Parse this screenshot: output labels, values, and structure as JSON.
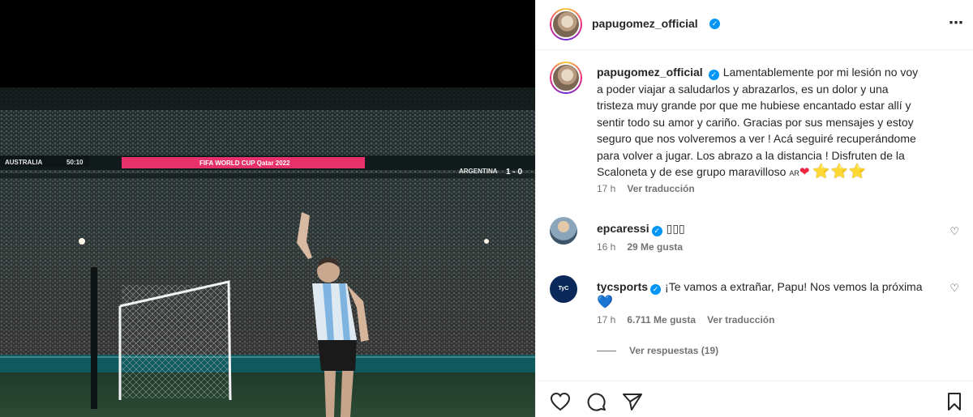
{
  "post": {
    "username": "papugomez_official",
    "more_icon": "⋯"
  },
  "scoreboard": {
    "team_home": "AUSTRALIA",
    "clock": "50:10",
    "banner": "FIFA WORLD CUP Qatar 2022",
    "team_away": "ARGENTINA",
    "score": "1 - 0"
  },
  "caption": {
    "username": "papugomez_official",
    "text": "Lamentablemente por mi lesión no voy a poder viajar a saludarlos y abrazarlos, es un dolor y una tristeza muy grande por que me hubiese encantado estar allí y sentir todo su amor y cariño. Gracias por sus mensajes y estoy seguro que nos volveremos a ver ! Acá seguiré recuperándome para volver a jugar. Los abrazo a la distancia ! Disfruten de la Scaloneta y de ese grupo maravilloso",
    "flag": "AR",
    "heart": "❤",
    "stars": "⭐⭐⭐",
    "time": "17 h",
    "translate": "Ver traducción"
  },
  "comments": [
    {
      "username": "epcaressi",
      "text": "▯▯▯",
      "time": "16 h",
      "likes": "29 Me gusta"
    },
    {
      "username": "tycsports",
      "avatar_label": "TyC Sports",
      "text": "¡Te vamos a extrañar, Papu! Nos vemos la próxima",
      "heart": "💙",
      "time": "17 h",
      "likes": "6.711 Me gusta",
      "translate": "Ver traducción"
    }
  ],
  "view_replies": "Ver respuestas (19)",
  "icons": {
    "like": "heart-outline-icon",
    "comment": "comment-bubble-icon",
    "share": "paper-plane-icon",
    "save": "bookmark-icon"
  },
  "colors": {
    "verified": "#0095f6",
    "text": "#262626",
    "secondary": "#737373",
    "banner": "#e8306a"
  }
}
